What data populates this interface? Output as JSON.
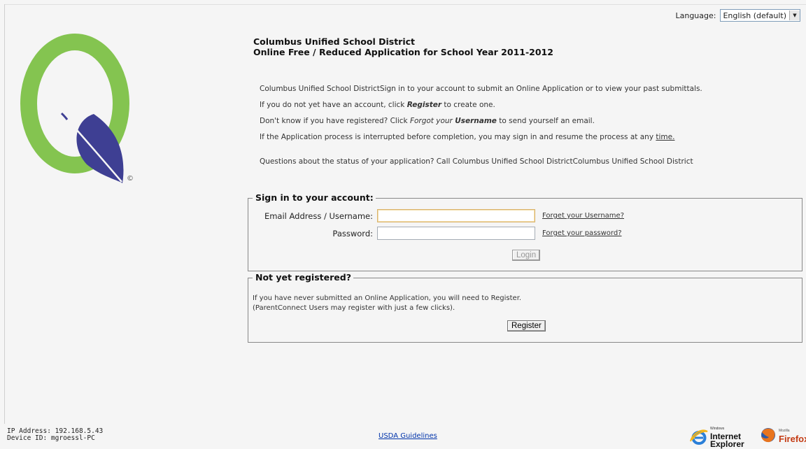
{
  "language": {
    "label": "Language:",
    "selected": "English (default)"
  },
  "header": {
    "line1": "Columbus Unified School District",
    "line2": "Online Free / Reduced Application for School Year 2011-2012"
  },
  "intro": {
    "p1": "Columbus Unified School DistrictSign in to your account to submit an Online Application or to view your past submittals.",
    "p2_pre": "If you do not yet have an account, click ",
    "p2_em": "Register",
    "p2_post": " to create one.",
    "p3_pre": "Don't know if you have registered? Click ",
    "p3_em1": "Forgot your ",
    "p3_em2": "Username",
    "p3_post": " to send yourself an email.",
    "p4_pre": "If the Application process is interrupted before completion, you may sign in and resume the process at any ",
    "p4_link": "time.",
    "questions": "Questions about the status of your application?  Call Columbus Unified School DistrictColumbus Unified School District"
  },
  "signin": {
    "legend": "Sign in to your account:",
    "email_label": "Email Address / Username:",
    "email_value": "",
    "forgot_username": "Forget your Username?",
    "password_label": "Password:",
    "password_value": "",
    "forgot_password": "Forget your password?",
    "login_button": "Login"
  },
  "register": {
    "legend": "Not yet registered?",
    "line1": "If you have never submitted an Online Application, you will need to Register.",
    "line2": "(ParentConnect Users may register with just a few clicks).",
    "register_button": "Register"
  },
  "footer": {
    "ip": "IP Address: 192.168.5.43",
    "device": "Device ID: mgroessl-PC",
    "usda_link": "USDA Guidelines",
    "ie_small": "Windows",
    "ie_line1": "Internet",
    "ie_line2": "Explorer",
    "ff_small": "Mozilla",
    "ff_name": "Firefox"
  },
  "logo": {
    "copyright": "©"
  },
  "colors": {
    "logo_green": "#84c450",
    "leaf_blue": "#3e3f93",
    "link_blue": "#0033aa"
  }
}
